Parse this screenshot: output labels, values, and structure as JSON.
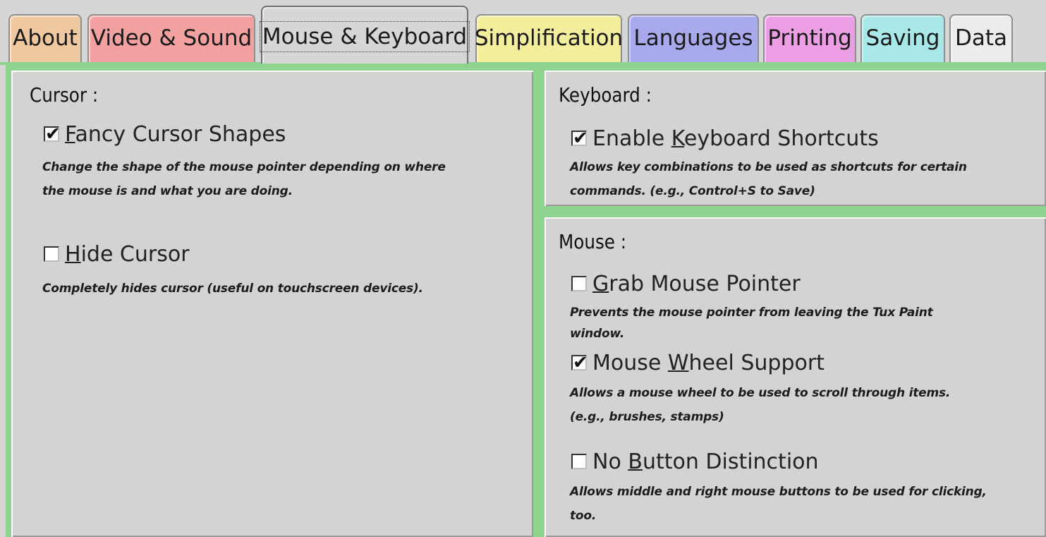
{
  "tabs": [
    {
      "label": "About",
      "color": "#f0c8a0",
      "active": false
    },
    {
      "label": "Video & Sound",
      "color": "#f2a0a0",
      "active": false
    },
    {
      "label": "Mouse & Keyboard",
      "color": "#d6d6d6",
      "active": true
    },
    {
      "label": "Simplification",
      "color": "#f2ee9c",
      "active": false
    },
    {
      "label": "Languages",
      "color": "#a8a8ec",
      "active": false
    },
    {
      "label": "Printing",
      "color": "#ec9ee4",
      "active": false
    },
    {
      "label": "Saving",
      "color": "#a8e8e8",
      "active": false
    },
    {
      "label": "Data",
      "color": "#ececec",
      "active": false
    }
  ],
  "accent_color": "#8ed48e",
  "cursor_section": {
    "title": "Cursor :",
    "fancy_cursor": {
      "checked": true,
      "label_before": "",
      "label_mnemonic": "F",
      "label_after": "ancy Cursor Shapes",
      "description_line1": "Change the shape of the mouse pointer depending on where",
      "description_line2": "the mouse is and what you are doing."
    },
    "hide_cursor": {
      "checked": false,
      "label_before": "",
      "label_mnemonic": "H",
      "label_after": "ide Cursor",
      "description_line1": "Completely hides cursor (useful on touchscreen devices)."
    }
  },
  "keyboard_section": {
    "title": "Keyboard :",
    "enable_shortcuts": {
      "checked": true,
      "label_before": "Enable ",
      "label_mnemonic": "K",
      "label_after": "eyboard Shortcuts",
      "description_line1": "Allows key combinations to be used as shortcuts for certain",
      "description_line2": "commands. (e.g., Control+S to Save)"
    }
  },
  "mouse_section": {
    "title": "Mouse :",
    "grab_pointer": {
      "checked": false,
      "label_before": "",
      "label_mnemonic": "G",
      "label_after": "rab Mouse Pointer",
      "description_line1": "Prevents the mouse pointer from leaving the Tux Paint",
      "description_line2": "window."
    },
    "wheel_support": {
      "checked": true,
      "label_before": "Mouse ",
      "label_mnemonic": "W",
      "label_after": "heel Support",
      "description_line1": "Allows a mouse wheel to be used to scroll through items.",
      "description_line2": "(e.g., brushes, stamps)"
    },
    "no_button_distinction": {
      "checked": false,
      "label_before": "No ",
      "label_mnemonic": "B",
      "label_after": "utton Distinction",
      "description_line1": "Allows middle and right mouse buttons to be used for clicking,",
      "description_line2": "too."
    }
  },
  "check_glyph": "✔"
}
